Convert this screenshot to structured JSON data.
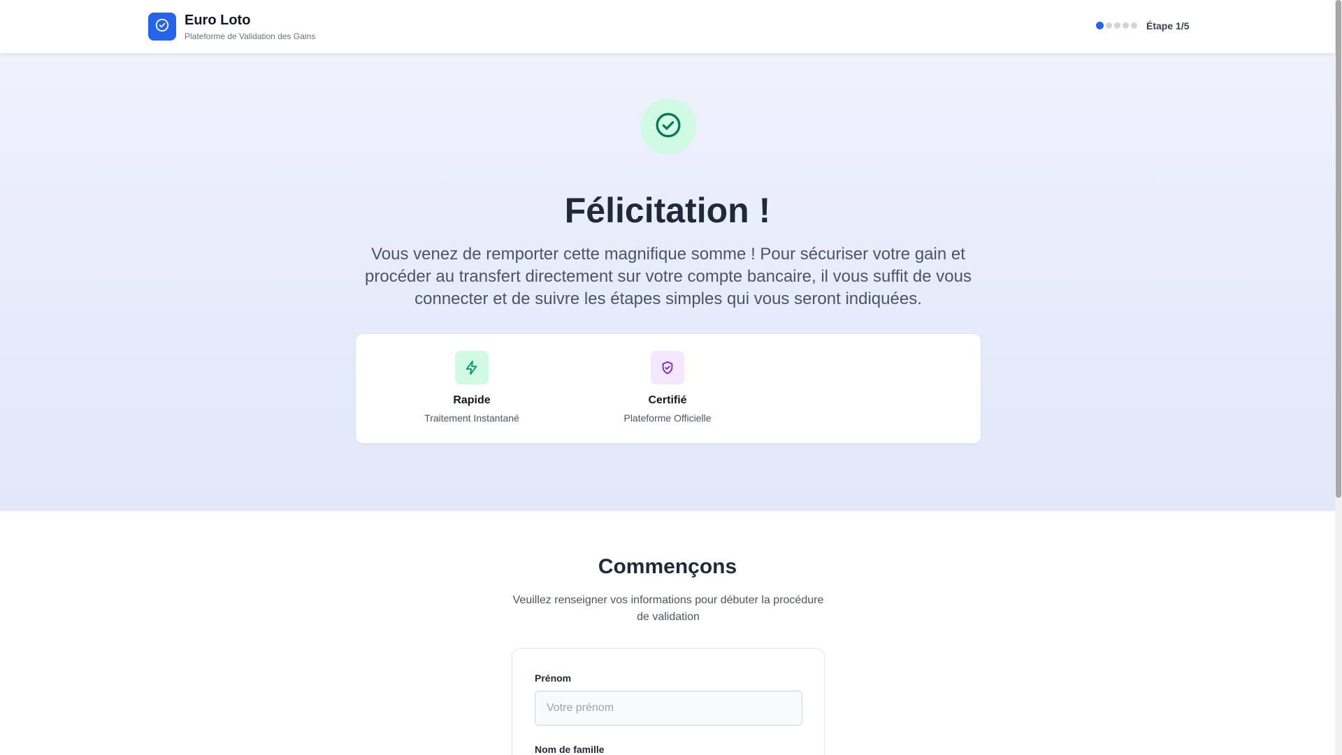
{
  "header": {
    "brand_title": "Euro Loto",
    "brand_subtitle": "Plateforme de Validation des Gains",
    "logo_icon": "check-circle-icon",
    "step_label": "Étape 1/5",
    "steps_total": 5,
    "steps_current": 1
  },
  "hero": {
    "icon": "check-circle-icon",
    "title": "Félicitation !",
    "text": "Vous venez de remporter cette magnifique somme ! Pour sécuriser votre gain et procéder au transfert directement sur votre compte bancaire, il vous suffit de vous connecter et de suivre les étapes simples qui vous seront indiquées.",
    "features": [
      {
        "icon": "lightning-icon",
        "title": "Rapide",
        "subtitle": "Traitement Instantané",
        "color": "#059669",
        "bg": "#d1fae5"
      },
      {
        "icon": "shield-check-icon",
        "title": "Certifié",
        "subtitle": "Plateforme Officielle",
        "color": "#7e22ce",
        "bg": "#f3e8ff"
      }
    ]
  },
  "form_section": {
    "title": "Commençons",
    "subtitle": "Veuillez renseigner vos informations pour débuter la procédure de validation",
    "fields": [
      {
        "label": "Prénom",
        "placeholder": "Votre prénom",
        "value": ""
      },
      {
        "label": "Nom de famille",
        "placeholder": "",
        "value": ""
      }
    ]
  },
  "colors": {
    "accent": "#2563eb",
    "success": "#059669",
    "success_bg": "#d1fae5"
  }
}
